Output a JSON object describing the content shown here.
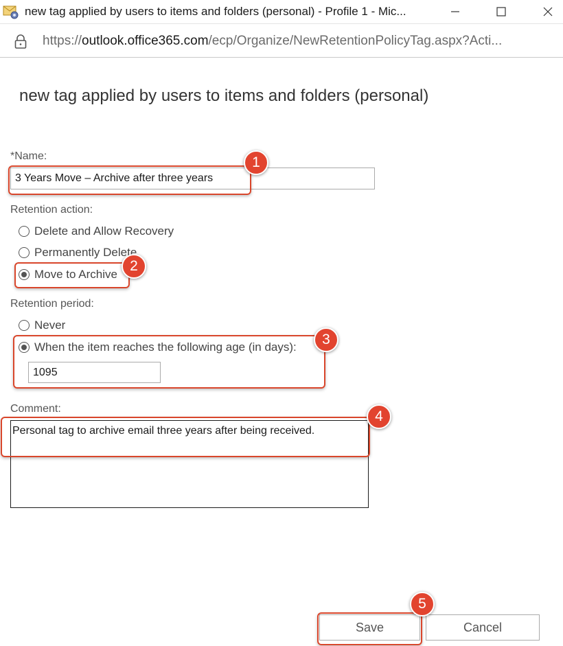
{
  "window": {
    "title": "new tag applied by users to items and folders (personal) - Profile 1 - Mic...",
    "url_prefix": "https://",
    "url_host": "outlook.office365.com",
    "url_path": "/ecp/Organize/NewRetentionPolicyTag.aspx?Acti..."
  },
  "page": {
    "title": "new tag applied by users to items and folders (personal)"
  },
  "form": {
    "name_label": "*Name:",
    "name_value": "3 Years Move – Archive after three years",
    "retention_action_label": "Retention action:",
    "action_options": [
      {
        "label": "Delete and Allow Recovery",
        "checked": false
      },
      {
        "label": "Permanently Delete",
        "checked": false
      },
      {
        "label": "Move to Archive",
        "checked": true
      }
    ],
    "retention_period_label": "Retention period:",
    "period_options": [
      {
        "label": "Never",
        "checked": false
      },
      {
        "label": "When the item reaches the following age (in days):",
        "checked": true
      }
    ],
    "age_days_value": "1095",
    "comment_label": "Comment:",
    "comment_value": "Personal tag to archive email three years after being received."
  },
  "buttons": {
    "save_label": "Save",
    "cancel_label": "Cancel"
  },
  "annotations": {
    "step1": "1",
    "step2": "2",
    "step3": "3",
    "step4": "4",
    "step5": "5",
    "color": "#e2442f"
  }
}
